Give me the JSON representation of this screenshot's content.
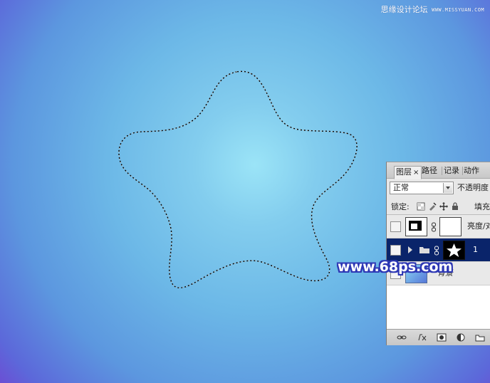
{
  "watermarks": {
    "top_left_text": "思缘设计论坛",
    "top_right_text": "WWW.MISSYUAN.COM",
    "center_text": "www.68ps.com"
  },
  "layers_panel": {
    "tabs": [
      {
        "label": "图层",
        "close": "×"
      },
      {
        "label": "路径"
      },
      {
        "label": "记录"
      },
      {
        "label": "动作"
      }
    ],
    "blend_mode": "正常",
    "opacity_label": "不透明度",
    "lock_label": "锁定:",
    "fill_label": "填充",
    "layers": [
      {
        "name": "亮度/对",
        "selected": false
      },
      {
        "name": "1",
        "selected": true
      },
      {
        "name": "背景",
        "selected": false
      }
    ]
  },
  "colors": {
    "panel_bg": "#e7e7e7",
    "selected_row": "#0a246a",
    "canvas_center": "#9be4f7",
    "canvas_edge": "#6b4fd4"
  },
  "icons": {
    "dropdown": "chevron-down-icon",
    "lock_transparency": "lock-transparency-icon",
    "lock_image": "lock-brush-icon",
    "lock_position": "lock-position-icon",
    "lock_all": "lock-all-icon",
    "link": "chain-icon",
    "fx": "fx-icon",
    "mask": "mask-icon",
    "adjustment": "adjustment-icon",
    "folder": "folder-icon"
  }
}
